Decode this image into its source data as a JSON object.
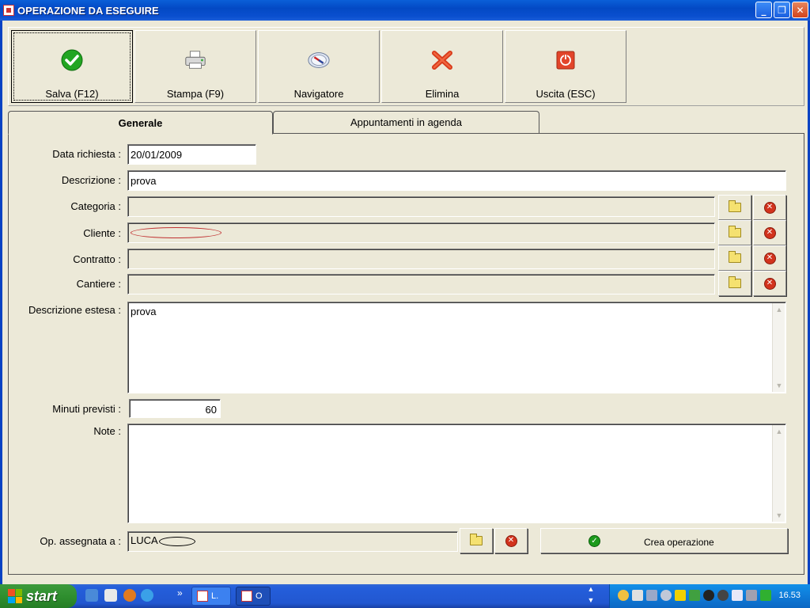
{
  "window": {
    "title": "OPERAZIONE DA ESEGUIRE"
  },
  "toolbar": {
    "items": [
      {
        "label": "Salva (F12)",
        "icon": "check-icon"
      },
      {
        "label": "Stampa (F9)",
        "icon": "printer-icon"
      },
      {
        "label": "Navigatore",
        "icon": "compass-icon"
      },
      {
        "label": "Elimina",
        "icon": "red-x-icon"
      },
      {
        "label": "Uscita (ESC)",
        "icon": "power-icon"
      }
    ]
  },
  "tabs": [
    {
      "label": "Generale",
      "active": true
    },
    {
      "label": "Appuntamenti in agenda",
      "active": false
    }
  ],
  "form": {
    "data_richiesta": {
      "label": "Data richiesta :",
      "value": "20/01/2009"
    },
    "descrizione": {
      "label": "Descrizione :",
      "value": "prova"
    },
    "categoria": {
      "label": "Categoria :",
      "value": ""
    },
    "cliente": {
      "label": "Cliente :",
      "value": ""
    },
    "contratto": {
      "label": "Contratto :",
      "value": ""
    },
    "cantiere": {
      "label": "Cantiere :",
      "value": ""
    },
    "descrizione_estesa": {
      "label": "Descrizione estesa :",
      "value": "prova"
    },
    "minuti_previsti": {
      "label": "Minuti previsti :",
      "value": "60"
    },
    "note": {
      "label": "Note :",
      "value": ""
    },
    "op_assegnata": {
      "label": "Op. assegnata a :",
      "value": "LUCA"
    }
  },
  "actions": {
    "crea_operazione": "Crea operazione"
  },
  "taskbar": {
    "start": "start",
    "tasks": [
      "L.",
      "O"
    ],
    "clock": "16.53",
    "chevron": "»"
  },
  "colors": {
    "accent": "#0a5fd8",
    "ok": "#1c9a1c",
    "danger": "#d2331d",
    "folder": "#f5e170"
  }
}
